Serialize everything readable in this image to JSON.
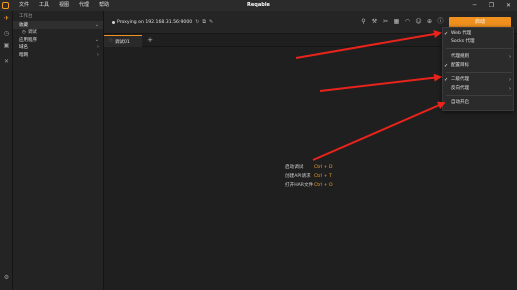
{
  "app": {
    "title": "Reqable"
  },
  "menu": [
    "文件",
    "工具",
    "视图",
    "代理",
    "帮助"
  ],
  "window_controls": {
    "minimize": "─",
    "restore": "❐",
    "close": "✕"
  },
  "sidebar": {
    "header": "工作台",
    "items": [
      {
        "label": "收藏",
        "expanded": true,
        "children": [
          {
            "label": "调试"
          }
        ]
      },
      {
        "label": "应用程序"
      },
      {
        "label": "域名"
      },
      {
        "label": "暗网"
      }
    ]
  },
  "toolbar": {
    "proxy_status": "Proxying on 192.168.31.56:9000",
    "start_button": "启动",
    "icons": [
      "filter-icon",
      "wrench-icon",
      "cut-icon",
      "grid-icon",
      "wifi-icon",
      "user-icon",
      "download-icon",
      "info-icon",
      "copy-icon",
      "shield-icon"
    ]
  },
  "tabs": [
    {
      "label": "调试01"
    }
  ],
  "hints": [
    {
      "label": "启动调试",
      "key": "Ctrl + D"
    },
    {
      "label": "创建API请求",
      "key": "Ctrl + T"
    },
    {
      "label": "打开HAR文件",
      "key": "Ctrl + O"
    }
  ],
  "dropdown": {
    "items": [
      {
        "label": "Web 代理",
        "checked": true
      },
      {
        "label": "Socks 代理",
        "checked": false
      },
      {
        "label": "代理规则",
        "submenu": true
      },
      {
        "label": "配置目标",
        "checked": true
      },
      {
        "label": "二级代理",
        "checked": true,
        "submenu": true
      },
      {
        "label": "反向代理",
        "submenu": true
      },
      {
        "label": "自动开启"
      }
    ]
  },
  "colors": {
    "accent": "#f0901e",
    "arrow": "#e8231c",
    "check": "#ffffff"
  }
}
